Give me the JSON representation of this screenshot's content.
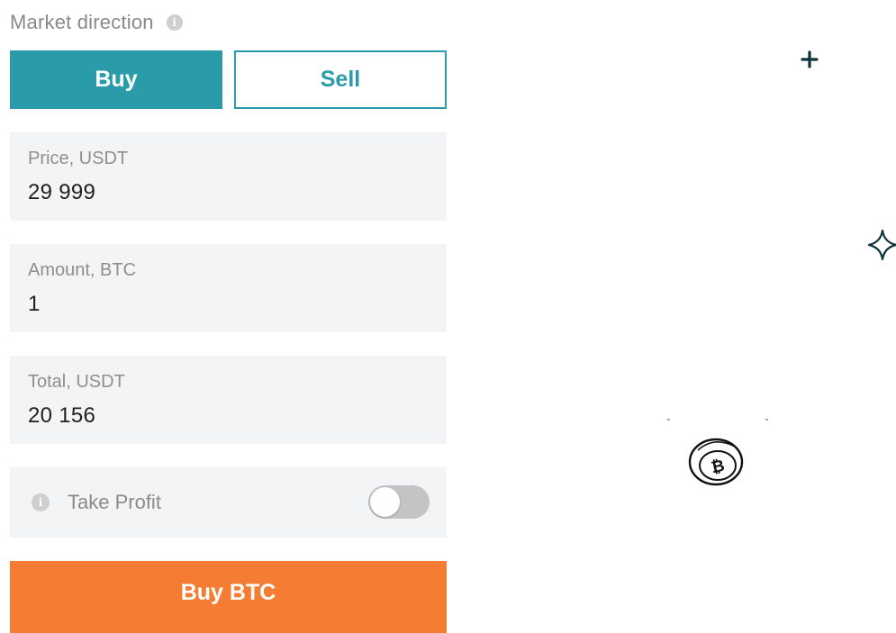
{
  "market_direction": {
    "label": "Market direction",
    "info_icon": "info-icon",
    "buy_label": "Buy",
    "sell_label": "Sell",
    "selected": "Buy"
  },
  "fields": {
    "price": {
      "label": "Price, USDT",
      "value": "29 999"
    },
    "amount": {
      "label": "Amount, BTC",
      "value": "1"
    },
    "total": {
      "label": "Total, USDT",
      "value": "20 156"
    }
  },
  "take_profit": {
    "label": "Take Profit",
    "enabled": false
  },
  "submit": {
    "label": "Buy BTC"
  },
  "colors": {
    "accent_teal": "#2a9ba9",
    "submit_orange": "#f57d33",
    "field_bg": "#f3f4f5",
    "sparkle_dark": "#0f3440"
  },
  "decorations": [
    "plus-sparkle-icon",
    "four-point-star-icon",
    "bitcoin-coin-icon"
  ]
}
